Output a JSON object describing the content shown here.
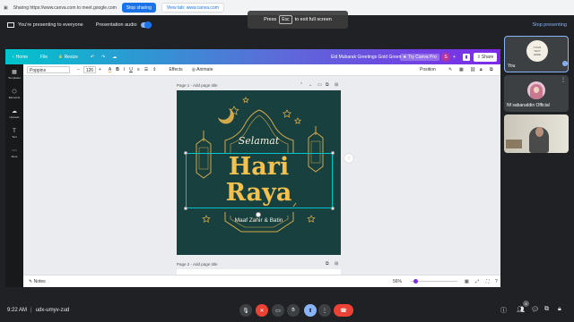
{
  "share_bar": {
    "sharing_text": "Sharing https://www.canva.com to meet.google.com",
    "stop_sharing": "Stop sharing",
    "view_tab": "View tab: www.canva.com"
  },
  "present_bar": {
    "presenting": "You're presenting to everyone",
    "audio": "Presentation audio",
    "stop": "Stop presenting"
  },
  "esc_hint": {
    "press": "Press",
    "key": "Esc",
    "rest": "to exit full screen"
  },
  "canva": {
    "home": "Home",
    "file": "File",
    "resize": "Resize",
    "doc_title": "Eid Mubarak Greetings Gold Green",
    "try_pro": "Try Canva Pro",
    "avatar_letter": "S",
    "share": "Share",
    "font": "Poppins",
    "font_size": "126",
    "effects": "Effects",
    "animate": "Animate",
    "position": "Position",
    "side": [
      {
        "label": "Templates",
        "icon": "▦"
      },
      {
        "label": "Elements",
        "icon": "⬡"
      },
      {
        "label": "Uploads",
        "icon": "☁"
      },
      {
        "label": "Text",
        "icon": "T"
      },
      {
        "label": "More",
        "icon": "⋯"
      }
    ],
    "page1": "Page 1 - Add page title",
    "page2": "Page 2 - Add page title",
    "notes": "Notes",
    "zoom": "56%"
  },
  "design": {
    "selamat": "Selamat",
    "hari": "Hari",
    "raya": "Raya",
    "names": "Maaf Zahir & Batin"
  },
  "participants": {
    "you_label": "You",
    "you_card": "YOUR TEXT HERE",
    "p2": "Nf sabaruddin Official"
  },
  "bottom": {
    "time": "9:22 AM",
    "meeting": "udx-umyv-zud",
    "badge": "4"
  },
  "colors": {
    "accent": "#1a73e8",
    "design_bg": "#18403f",
    "gold": "#f2c14e",
    "end_call": "#ea4335"
  }
}
